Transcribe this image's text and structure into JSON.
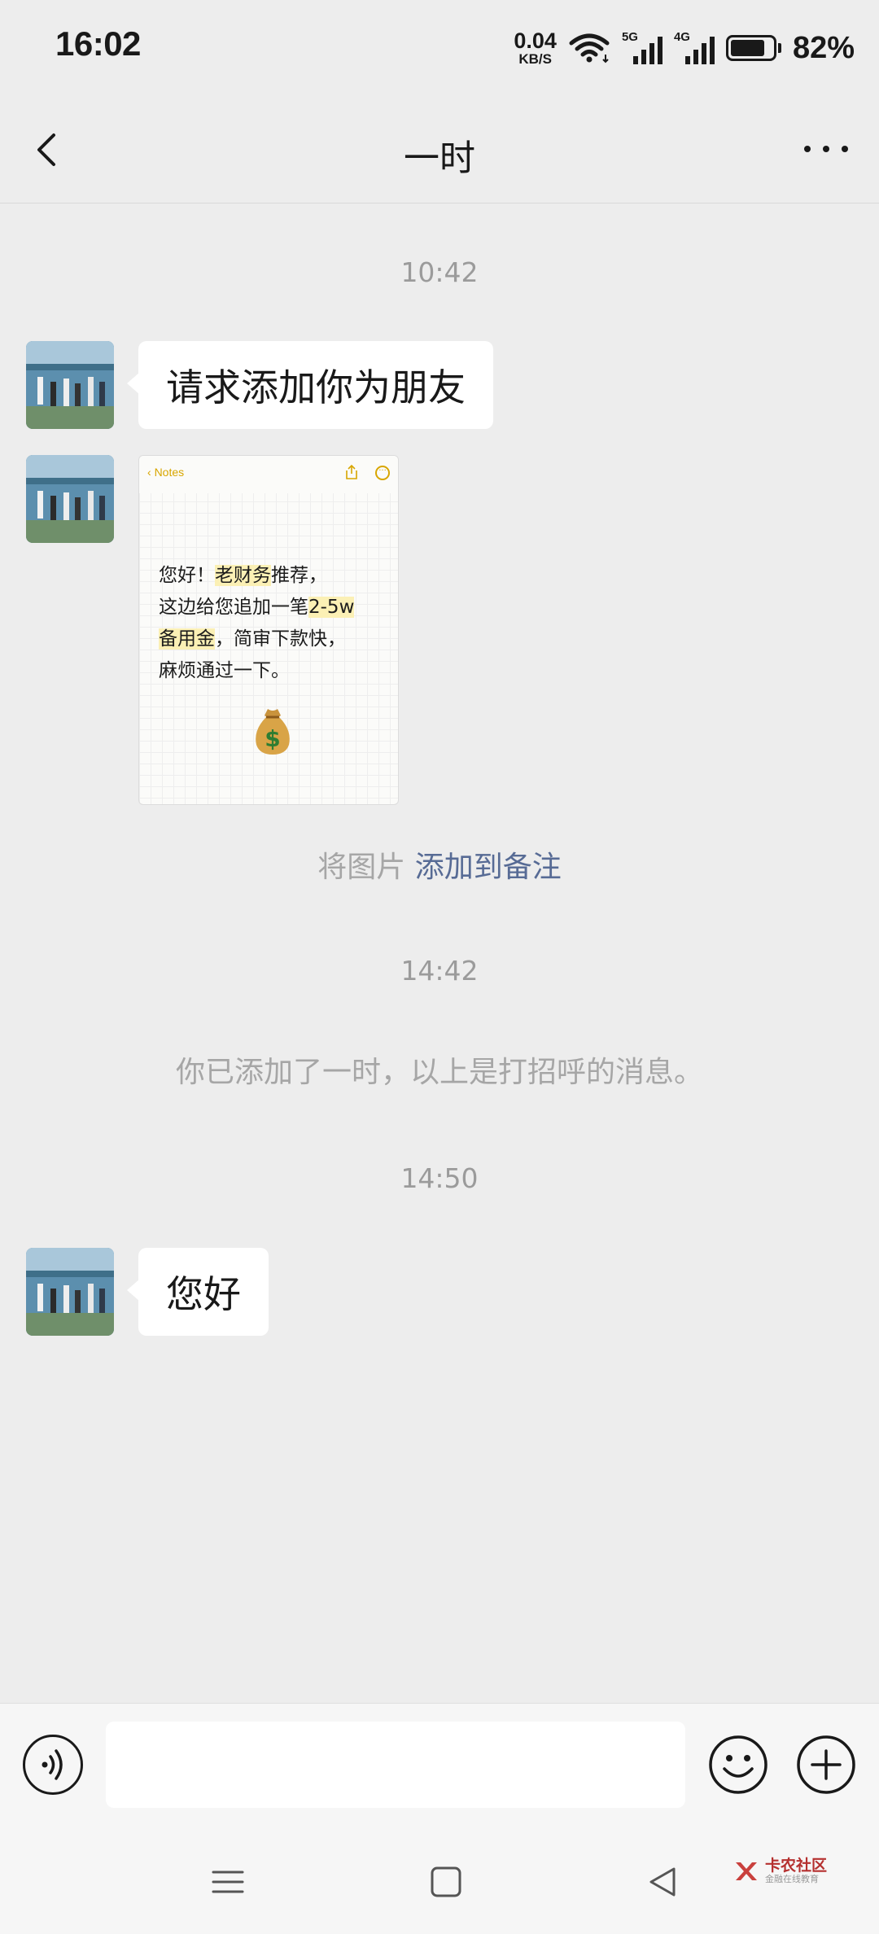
{
  "status_bar": {
    "time": "16:02",
    "net_speed_value": "0.04",
    "net_speed_unit": "KB/S",
    "signal_1_type": "5G",
    "signal_2_type": "4G",
    "battery_percent_label": "82%",
    "battery_level": 0.82
  },
  "header": {
    "title": "一时"
  },
  "messages": {
    "ts_1": "10:42",
    "msg_1": "请求添加你为朋友",
    "image_note": {
      "back_label": "Notes",
      "line_1_a": "您好！",
      "line_1_hl": "老财务",
      "line_1_b": "推荐，",
      "line_2_a": "这边给您追加一笔",
      "line_2_hl": "2-5w",
      "line_3_hl": "备用金",
      "line_3_b": "，简审下款快，",
      "line_4": "麻烦通过一下。"
    },
    "note_prompt_text": "将图片",
    "note_prompt_link": "添加到备注",
    "ts_2": "14:42",
    "system_notice": "你已添加了一时，以上是打招呼的消息。",
    "ts_3": "14:50",
    "msg_2": "您好"
  },
  "input": {
    "value": ""
  },
  "watermark": {
    "main": "卡农社区",
    "sub": "金融在线教育"
  },
  "colors": {
    "background": "#ededed",
    "bubble": "#ffffff",
    "link": "#576b95",
    "highlight": "#fbf0b5",
    "notes_accent": "#d8a600"
  }
}
